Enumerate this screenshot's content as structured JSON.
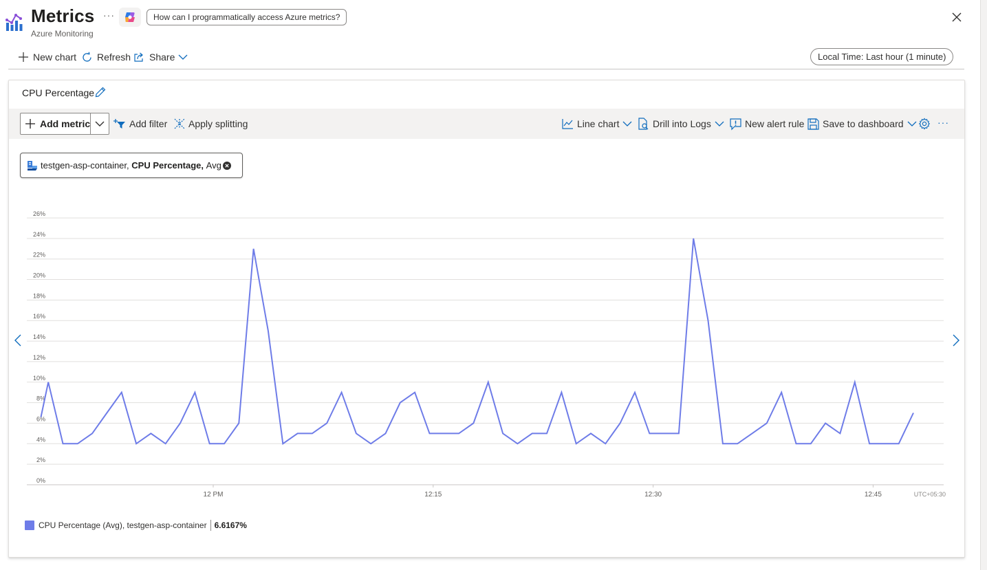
{
  "header": {
    "title": "Metrics",
    "subtitle": "Azure Monitoring",
    "more_label": "···",
    "copilot_prompt": "How can I programmatically access Azure metrics?"
  },
  "command_bar": {
    "new_chart": "New chart",
    "refresh": "Refresh",
    "share": "Share",
    "time_range": "Local Time: Last hour (1 minute)"
  },
  "chart_panel": {
    "title": "CPU Percentage",
    "toolbar": {
      "add_metric": "Add metric",
      "add_filter": "Add filter",
      "apply_splitting": "Apply splitting",
      "line_chart": "Line chart",
      "drill_into_logs": "Drill into Logs",
      "new_alert_rule": "New alert rule",
      "save_to_dashboard": "Save to dashboard",
      "more": "···"
    },
    "metric_pill": {
      "resource": "testgen-asp-container,",
      "metric": "CPU Percentage,",
      "aggregation": "Avg"
    },
    "legend": {
      "label": "CPU Percentage (Avg), testgen-asp-container",
      "value": "6.6167%"
    }
  },
  "chart_data": {
    "type": "line",
    "series": [
      {
        "name": "CPU Percentage (Avg), testgen-asp-container",
        "color": "#6e7ce8",
        "x_minutes": [
          -11.75,
          -11.25,
          -10.25,
          -9.25,
          -8.25,
          -7.25,
          -6.25,
          -5.25,
          -4.25,
          -3.25,
          -2.25,
          -1.25,
          -0.25,
          0.75,
          1.75,
          2.75,
          3.75,
          4.75,
          5.75,
          6.75,
          7.75,
          8.75,
          9.75,
          10.75,
          11.75,
          12.75,
          13.75,
          14.75,
          15.75,
          16.75,
          17.75,
          18.75,
          19.75,
          20.75,
          21.75,
          22.75,
          23.75,
          24.75,
          25.75,
          26.75,
          27.75,
          28.75,
          29.75,
          30.75,
          31.75,
          32.75,
          33.75,
          34.75,
          35.75,
          36.75,
          37.75,
          38.75,
          39.75,
          40.75,
          41.75,
          42.75,
          43.75,
          44.75,
          45.75,
          46.75,
          47.75
        ],
        "values": [
          6.6,
          10,
          4,
          4,
          5,
          7,
          9,
          4,
          5,
          4,
          6,
          9,
          4,
          4,
          6,
          23,
          15,
          4,
          5,
          5,
          6,
          9,
          5,
          4,
          5,
          8,
          9,
          5,
          5,
          5,
          6,
          10,
          5,
          4,
          5,
          5,
          9,
          4,
          5,
          4,
          6,
          9,
          5,
          5,
          5,
          24,
          16,
          4,
          4,
          5,
          6,
          9,
          4,
          4,
          6,
          5,
          10,
          4,
          4,
          4,
          7
        ]
      }
    ],
    "x_axis": {
      "ticks": [
        "12 PM",
        "12:15",
        "12:30",
        "12:45"
      ],
      "tick_minutes": [
        0,
        15,
        30,
        45
      ],
      "timezone_label": "UTC+05:30"
    },
    "y_axis": {
      "ticks": [
        "0%",
        "2%",
        "4%",
        "6%",
        "8%",
        "10%",
        "12%",
        "14%",
        "16%",
        "18%",
        "20%",
        "22%",
        "24%",
        "26%"
      ],
      "ylim": [
        0,
        26
      ],
      "unit": "%"
    },
    "grid": true,
    "legend_position": "bottom-left"
  }
}
